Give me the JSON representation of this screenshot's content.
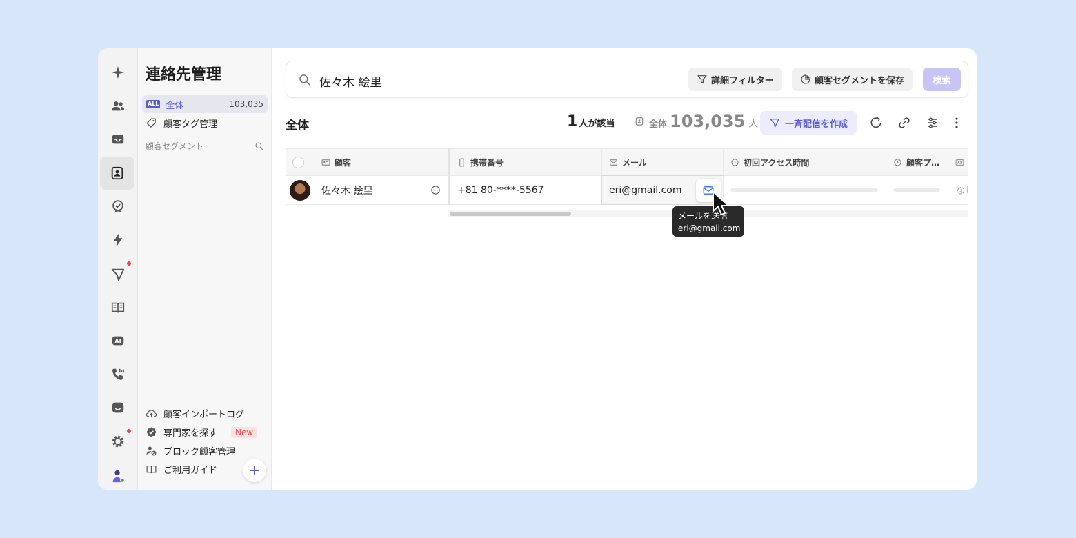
{
  "sidebar": {
    "title": "連絡先管理",
    "all": {
      "badge": "ALL",
      "label": "全体",
      "count": "103,035"
    },
    "tag_label": "顧客タグ管理",
    "segment_label": "顧客セグメント",
    "import_log": "顧客インポートログ",
    "find_expert": "専門家を探す",
    "new_badge": "New",
    "block": "ブロック顧客管理",
    "guide": "ご利用ガイド",
    "add": "+"
  },
  "search": {
    "value": "佐々木 絵里",
    "detail_filter": "詳細フィルター",
    "save_segment": "顧客セグメントを保存",
    "search_button": "検索"
  },
  "list": {
    "title": "全体",
    "match_count": "1",
    "match_suffix": "人が該当",
    "total_prefix": "全体",
    "total_count": "103,035",
    "total_unit": "人",
    "broadcast": "一斉配信を作成"
  },
  "table": {
    "headers": {
      "customer": "顧客",
      "mobile": "携帯番号",
      "email": "メール",
      "first_access": "初回アクセス時間",
      "customer_profile": "顧客プ…"
    },
    "row": {
      "name": "佐々木 絵里",
      "mobile": "+81 80-****-5567",
      "email": "eri@gmail.com",
      "last_col": "なし"
    }
  },
  "tooltip": {
    "line1": "メールを送信",
    "line2": "eri@gmail.com"
  },
  "colors": {
    "accent": "#5b5bd6",
    "background": "#d8e6fc",
    "danger": "#e5484d"
  }
}
